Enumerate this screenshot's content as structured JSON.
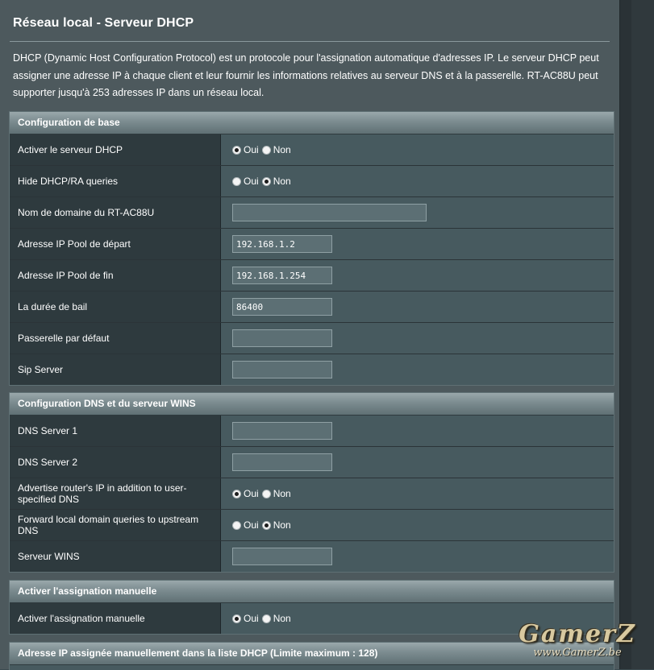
{
  "page": {
    "title": "Réseau local - Serveur DHCP",
    "description": "DHCP (Dynamic Host Configuration Protocol) est un protocole pour l'assignation automatique d'adresses IP. Le serveur DHCP peut assigner une adresse IP à chaque client et leur fournir les informations relatives au serveur DNS et à la passerelle. RT-AC88U peut supporter jusqu'à 253 adresses IP dans un réseau local."
  },
  "radio_labels": {
    "yes": "Oui",
    "no": "Non"
  },
  "basic": {
    "header": "Configuration de base",
    "enable_dhcp": {
      "label": "Activer le serveur DHCP",
      "selected": "Oui"
    },
    "hide_dhcp_ra": {
      "label": "Hide DHCP/RA queries",
      "selected": "Non"
    },
    "domain_name": {
      "label": "Nom de domaine du RT-AC88U",
      "value": ""
    },
    "ip_pool_start": {
      "label": "Adresse IP Pool de départ",
      "value": "192.168.1.2"
    },
    "ip_pool_end": {
      "label": "Adresse IP Pool de fin",
      "value": "192.168.1.254"
    },
    "lease_time": {
      "label": "La durée de bail",
      "value": "86400"
    },
    "default_gateway": {
      "label": "Passerelle par défaut",
      "value": ""
    },
    "sip_server": {
      "label": "Sip Server",
      "value": ""
    }
  },
  "dns": {
    "header": "Configuration DNS et du serveur WINS",
    "dns1": {
      "label": "DNS Server 1",
      "value": ""
    },
    "dns2": {
      "label": "DNS Server 2",
      "value": ""
    },
    "advertise_router_ip": {
      "label": "Advertise router's IP in addition to user-specified DNS",
      "selected": "Oui"
    },
    "forward_local_domain": {
      "label": "Forward local domain queries to upstream DNS",
      "selected": "Non"
    },
    "wins": {
      "label": "Serveur WINS",
      "value": ""
    }
  },
  "manual": {
    "header": "Activer l'assignation manuelle",
    "enable_manual": {
      "label": "Activer l'assignation manuelle",
      "selected": "Oui"
    }
  },
  "manual_list": {
    "header": "Adresse IP assignée manuellement dans la liste DHCP (Limite maximum : 128)"
  },
  "watermark": {
    "logo": "GamerZ",
    "url": "www.GamerZ.be"
  },
  "colors": {
    "panel_bg": "#4d595d",
    "label_bg": "#2e3a3e",
    "value_bg": "#475a5f",
    "header_grad_top": "#9aa8ab",
    "header_grad_bottom": "#5f7074",
    "input_bg": "#5c6f74"
  }
}
